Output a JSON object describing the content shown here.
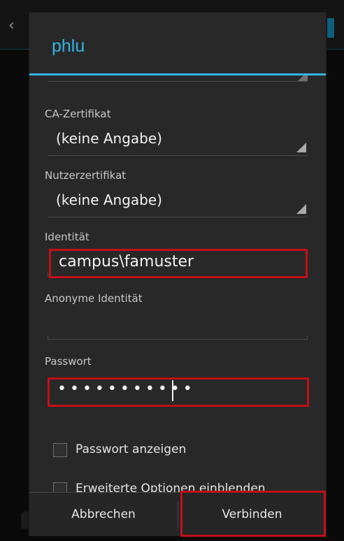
{
  "dialog": {
    "title": "phlu"
  },
  "fields": {
    "ca_cert_label": "CA-Zertifikat",
    "ca_cert_value": "(keine Angabe)",
    "user_cert_label": "Nutzerzertifikat",
    "user_cert_value": "(keine Angabe)",
    "identity_label": "Identität",
    "identity_value": "campus\\famuster",
    "anon_identity_label": "Anonyme Identität",
    "anon_identity_value": "",
    "password_label": "Passwort",
    "password_mask": "•••••••••••"
  },
  "options": {
    "show_password_label": "Passwort anzeigen",
    "show_password_checked": false,
    "advanced_label": "Erweiterte Optionen einblenden",
    "advanced_checked": false
  },
  "buttons": {
    "cancel_label": "Abbrechen",
    "connect_label": "Verbinden"
  },
  "colors": {
    "accent": "#33b5e5",
    "highlight": "#c20f17",
    "dialog_bg": "#282828"
  }
}
